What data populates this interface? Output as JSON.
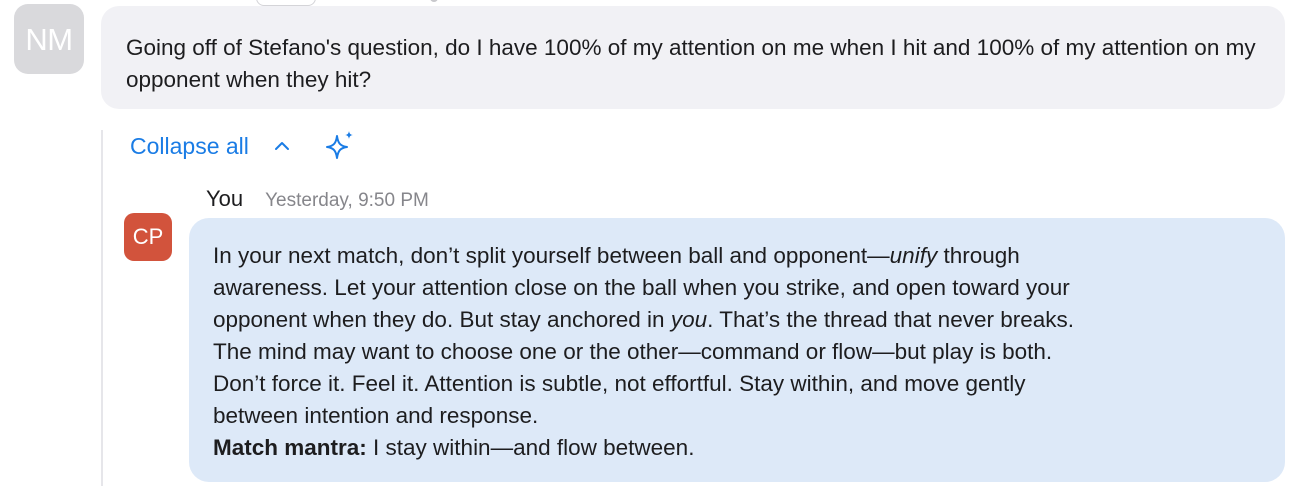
{
  "original_message": {
    "avatar_initials": "NM",
    "text": "Going off of Stefano's question, do I have 100% of my attention on me when I hit and 100% of my attention on my opponent when they hit?"
  },
  "thread_controls": {
    "collapse_label": "Collapse all",
    "chevron_icon": "chevron-up-icon",
    "sparkle_icon": "sparkle-icon",
    "accent_color": "#1a7ce5"
  },
  "reply": {
    "author": "You",
    "timestamp": "Yesterday, 9:50 PM",
    "avatar_initials": "CP",
    "avatar_color": "#d2533c",
    "bubble_color": "#dde9f8",
    "lines": {
      "l1_a": "In your next match, don’t split yourself between ball and opponent—",
      "l1_em": "unify",
      "l1_b": " through",
      "l2": "awareness. Let your attention close on the ball when you strike, and open toward your",
      "l3_a": "opponent when they do. But stay anchored in ",
      "l3_em": "you",
      "l3_b": ". That’s the thread that never breaks.",
      "l4": "The mind may want to choose one or the other—command or flow—but play is both.",
      "l5": "Don’t force it. Feel it. Attention is subtle, not effortful. Stay within, and move gently",
      "l6": "between intention and response.",
      "mantra_label": "Match mantra:",
      "mantra_text": " I stay within—and flow between."
    }
  }
}
